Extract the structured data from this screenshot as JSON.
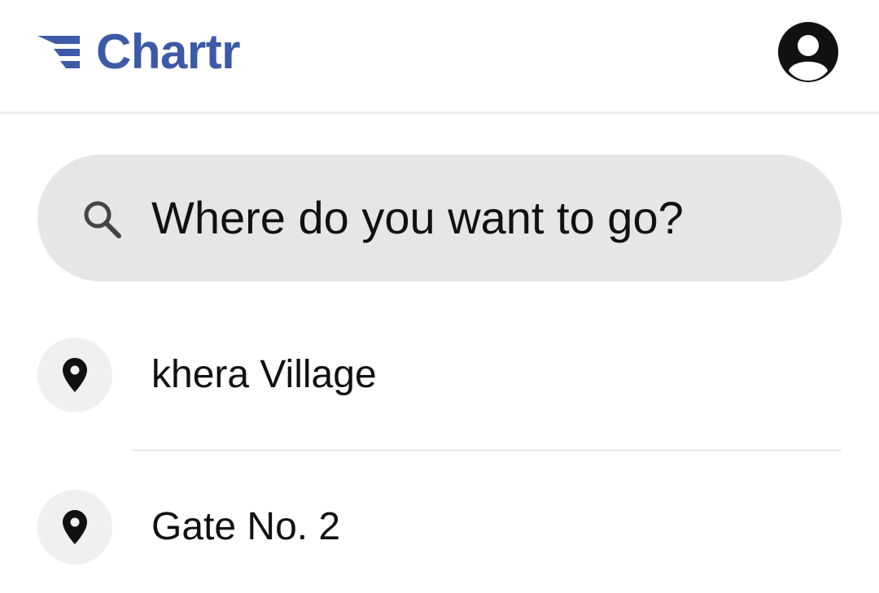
{
  "header": {
    "brand_name": "Chartr",
    "brand_color": "#3d5aa8",
    "logo_icon": "chartr-logo-icon",
    "profile_icon": "account-circle-icon"
  },
  "search": {
    "placeholder": "Where do you want to go?",
    "icon": "search-icon",
    "background": "#e6e6e6"
  },
  "suggestions": [
    {
      "label": "khera Village",
      "icon": "location-pin-icon"
    },
    {
      "label": "Gate No. 2",
      "icon": "location-pin-icon"
    }
  ]
}
